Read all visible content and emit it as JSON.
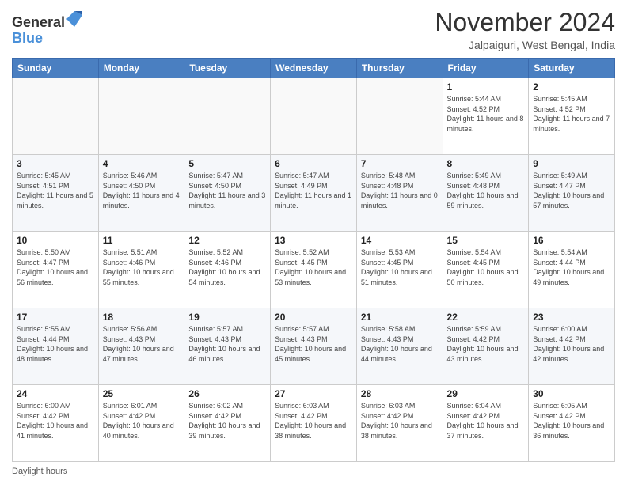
{
  "logo": {
    "general": "General",
    "blue": "Blue"
  },
  "header": {
    "month": "November 2024",
    "location": "Jalpaiguri, West Bengal, India"
  },
  "days_of_week": [
    "Sunday",
    "Monday",
    "Tuesday",
    "Wednesday",
    "Thursday",
    "Friday",
    "Saturday"
  ],
  "footer": {
    "daylight_label": "Daylight hours"
  },
  "weeks": [
    [
      {
        "day": "",
        "info": ""
      },
      {
        "day": "",
        "info": ""
      },
      {
        "day": "",
        "info": ""
      },
      {
        "day": "",
        "info": ""
      },
      {
        "day": "",
        "info": ""
      },
      {
        "day": "1",
        "info": "Sunrise: 5:44 AM\nSunset: 4:52 PM\nDaylight: 11 hours and 8 minutes."
      },
      {
        "day": "2",
        "info": "Sunrise: 5:45 AM\nSunset: 4:52 PM\nDaylight: 11 hours and 7 minutes."
      }
    ],
    [
      {
        "day": "3",
        "info": "Sunrise: 5:45 AM\nSunset: 4:51 PM\nDaylight: 11 hours and 5 minutes."
      },
      {
        "day": "4",
        "info": "Sunrise: 5:46 AM\nSunset: 4:50 PM\nDaylight: 11 hours and 4 minutes."
      },
      {
        "day": "5",
        "info": "Sunrise: 5:47 AM\nSunset: 4:50 PM\nDaylight: 11 hours and 3 minutes."
      },
      {
        "day": "6",
        "info": "Sunrise: 5:47 AM\nSunset: 4:49 PM\nDaylight: 11 hours and 1 minute."
      },
      {
        "day": "7",
        "info": "Sunrise: 5:48 AM\nSunset: 4:48 PM\nDaylight: 11 hours and 0 minutes."
      },
      {
        "day": "8",
        "info": "Sunrise: 5:49 AM\nSunset: 4:48 PM\nDaylight: 10 hours and 59 minutes."
      },
      {
        "day": "9",
        "info": "Sunrise: 5:49 AM\nSunset: 4:47 PM\nDaylight: 10 hours and 57 minutes."
      }
    ],
    [
      {
        "day": "10",
        "info": "Sunrise: 5:50 AM\nSunset: 4:47 PM\nDaylight: 10 hours and 56 minutes."
      },
      {
        "day": "11",
        "info": "Sunrise: 5:51 AM\nSunset: 4:46 PM\nDaylight: 10 hours and 55 minutes."
      },
      {
        "day": "12",
        "info": "Sunrise: 5:52 AM\nSunset: 4:46 PM\nDaylight: 10 hours and 54 minutes."
      },
      {
        "day": "13",
        "info": "Sunrise: 5:52 AM\nSunset: 4:45 PM\nDaylight: 10 hours and 53 minutes."
      },
      {
        "day": "14",
        "info": "Sunrise: 5:53 AM\nSunset: 4:45 PM\nDaylight: 10 hours and 51 minutes."
      },
      {
        "day": "15",
        "info": "Sunrise: 5:54 AM\nSunset: 4:45 PM\nDaylight: 10 hours and 50 minutes."
      },
      {
        "day": "16",
        "info": "Sunrise: 5:54 AM\nSunset: 4:44 PM\nDaylight: 10 hours and 49 minutes."
      }
    ],
    [
      {
        "day": "17",
        "info": "Sunrise: 5:55 AM\nSunset: 4:44 PM\nDaylight: 10 hours and 48 minutes."
      },
      {
        "day": "18",
        "info": "Sunrise: 5:56 AM\nSunset: 4:43 PM\nDaylight: 10 hours and 47 minutes."
      },
      {
        "day": "19",
        "info": "Sunrise: 5:57 AM\nSunset: 4:43 PM\nDaylight: 10 hours and 46 minutes."
      },
      {
        "day": "20",
        "info": "Sunrise: 5:57 AM\nSunset: 4:43 PM\nDaylight: 10 hours and 45 minutes."
      },
      {
        "day": "21",
        "info": "Sunrise: 5:58 AM\nSunset: 4:43 PM\nDaylight: 10 hours and 44 minutes."
      },
      {
        "day": "22",
        "info": "Sunrise: 5:59 AM\nSunset: 4:42 PM\nDaylight: 10 hours and 43 minutes."
      },
      {
        "day": "23",
        "info": "Sunrise: 6:00 AM\nSunset: 4:42 PM\nDaylight: 10 hours and 42 minutes."
      }
    ],
    [
      {
        "day": "24",
        "info": "Sunrise: 6:00 AM\nSunset: 4:42 PM\nDaylight: 10 hours and 41 minutes."
      },
      {
        "day": "25",
        "info": "Sunrise: 6:01 AM\nSunset: 4:42 PM\nDaylight: 10 hours and 40 minutes."
      },
      {
        "day": "26",
        "info": "Sunrise: 6:02 AM\nSunset: 4:42 PM\nDaylight: 10 hours and 39 minutes."
      },
      {
        "day": "27",
        "info": "Sunrise: 6:03 AM\nSunset: 4:42 PM\nDaylight: 10 hours and 38 minutes."
      },
      {
        "day": "28",
        "info": "Sunrise: 6:03 AM\nSunset: 4:42 PM\nDaylight: 10 hours and 38 minutes."
      },
      {
        "day": "29",
        "info": "Sunrise: 6:04 AM\nSunset: 4:42 PM\nDaylight: 10 hours and 37 minutes."
      },
      {
        "day": "30",
        "info": "Sunrise: 6:05 AM\nSunset: 4:42 PM\nDaylight: 10 hours and 36 minutes."
      }
    ]
  ]
}
